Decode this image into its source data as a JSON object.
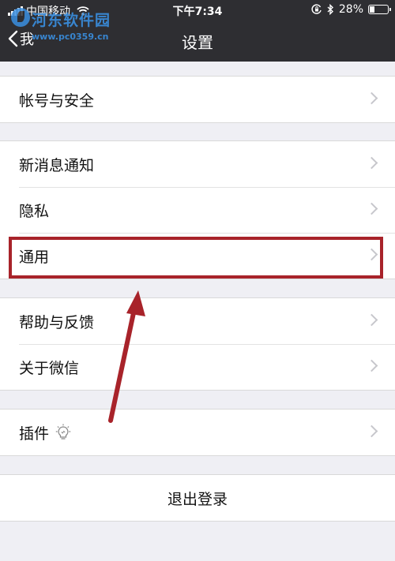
{
  "status_bar": {
    "carrier": "中国移动",
    "time": "下午7:34",
    "battery_text": "28%",
    "battery_level": 0.28
  },
  "watermark": {
    "name": "河东软件园",
    "url": "www.pc0359.cn"
  },
  "nav": {
    "back_label": "我",
    "title": "设置"
  },
  "groups": [
    {
      "items": [
        {
          "label": "帐号与安全"
        }
      ]
    },
    {
      "items": [
        {
          "label": "新消息通知"
        },
        {
          "label": "隐私"
        },
        {
          "label": "通用"
        }
      ]
    },
    {
      "items": [
        {
          "label": "帮助与反馈"
        },
        {
          "label": "关于微信"
        }
      ]
    },
    {
      "items": [
        {
          "label": "插件"
        }
      ]
    }
  ],
  "logout_label": "退出登录",
  "icons": {
    "back": "chevron-left-icon",
    "chevron": "chevron-right-icon",
    "plugin_badge": "lightbulb-icon",
    "bluetooth": "bluetooth-icon",
    "rotation_lock": "rotation-lock-icon"
  },
  "colors": {
    "topbar": "#2e2e32",
    "background": "#efeff4",
    "annotation": "#a8232a",
    "watermark": "#3a8fe0"
  }
}
